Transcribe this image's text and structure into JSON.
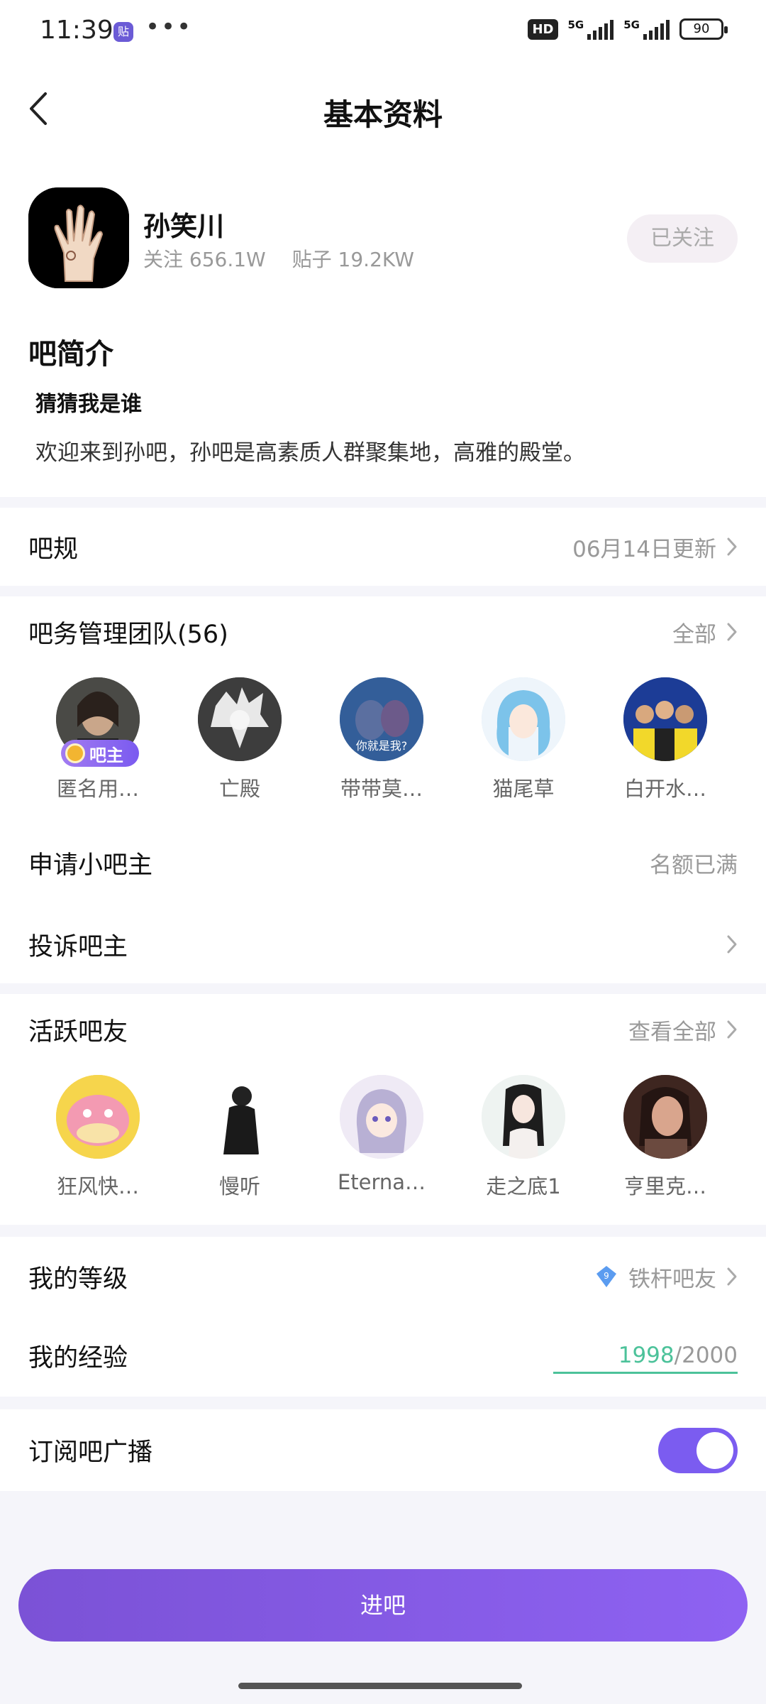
{
  "status_bar": {
    "time": "11:39",
    "app_badge": "贴",
    "more": "•••",
    "hd": "HD",
    "network1": "5G",
    "network2": "5G",
    "battery": "90"
  },
  "nav": {
    "title": "基本资料",
    "back_icon": "chevron-left-icon"
  },
  "forum": {
    "name": "孙笑川",
    "followers_label": "关注 656.1W",
    "posts_label": "贴子 19.2KW",
    "follow_button": "已关注"
  },
  "intro": {
    "title": "吧简介",
    "subtitle": "猜猜我是谁",
    "text": "欢迎来到孙吧，孙吧是高素质人群聚集地，高雅的殿堂。"
  },
  "rules": {
    "label": "吧规",
    "value": "06月14日更新"
  },
  "team": {
    "label": "吧务管理团队(56)",
    "action": "全部",
    "members": [
      {
        "name": "匿名用…",
        "badge": "吧主",
        "color": "#3a3a3a"
      },
      {
        "name": "亡殿",
        "color": "#2b2b2b"
      },
      {
        "name": "带带莫…",
        "overlay": "你就是我?",
        "color": "#3f6fa8"
      },
      {
        "name": "猫尾草",
        "color": "#cfe6f5"
      },
      {
        "name": "白开水…",
        "color": "#1f3c8c"
      }
    ]
  },
  "apply": {
    "label": "申请小吧主",
    "value": "名额已满"
  },
  "complain": {
    "label": "投诉吧主"
  },
  "active": {
    "label": "活跃吧友",
    "action": "查看全部",
    "members": [
      {
        "name": "狂风快…",
        "color": "#f4c73a"
      },
      {
        "name": "慢听",
        "color": "#ffffff"
      },
      {
        "name": "Eterna…",
        "color": "#e3dcee"
      },
      {
        "name": "走之底1",
        "color": "#eef2f0"
      },
      {
        "name": "亨里克…",
        "color": "#5a3a30"
      }
    ]
  },
  "level": {
    "label": "我的等级",
    "value": "铁杆吧友",
    "level_num": "9"
  },
  "experience": {
    "label": "我的经验",
    "current": "1998",
    "separator": "/",
    "max": "2000",
    "progress": 0.999
  },
  "subscribe": {
    "label": "订阅吧广播",
    "enabled": true
  },
  "enter_button": "进吧",
  "colors": {
    "accent": "#7b5cf0",
    "progress": "#4cc29a"
  }
}
